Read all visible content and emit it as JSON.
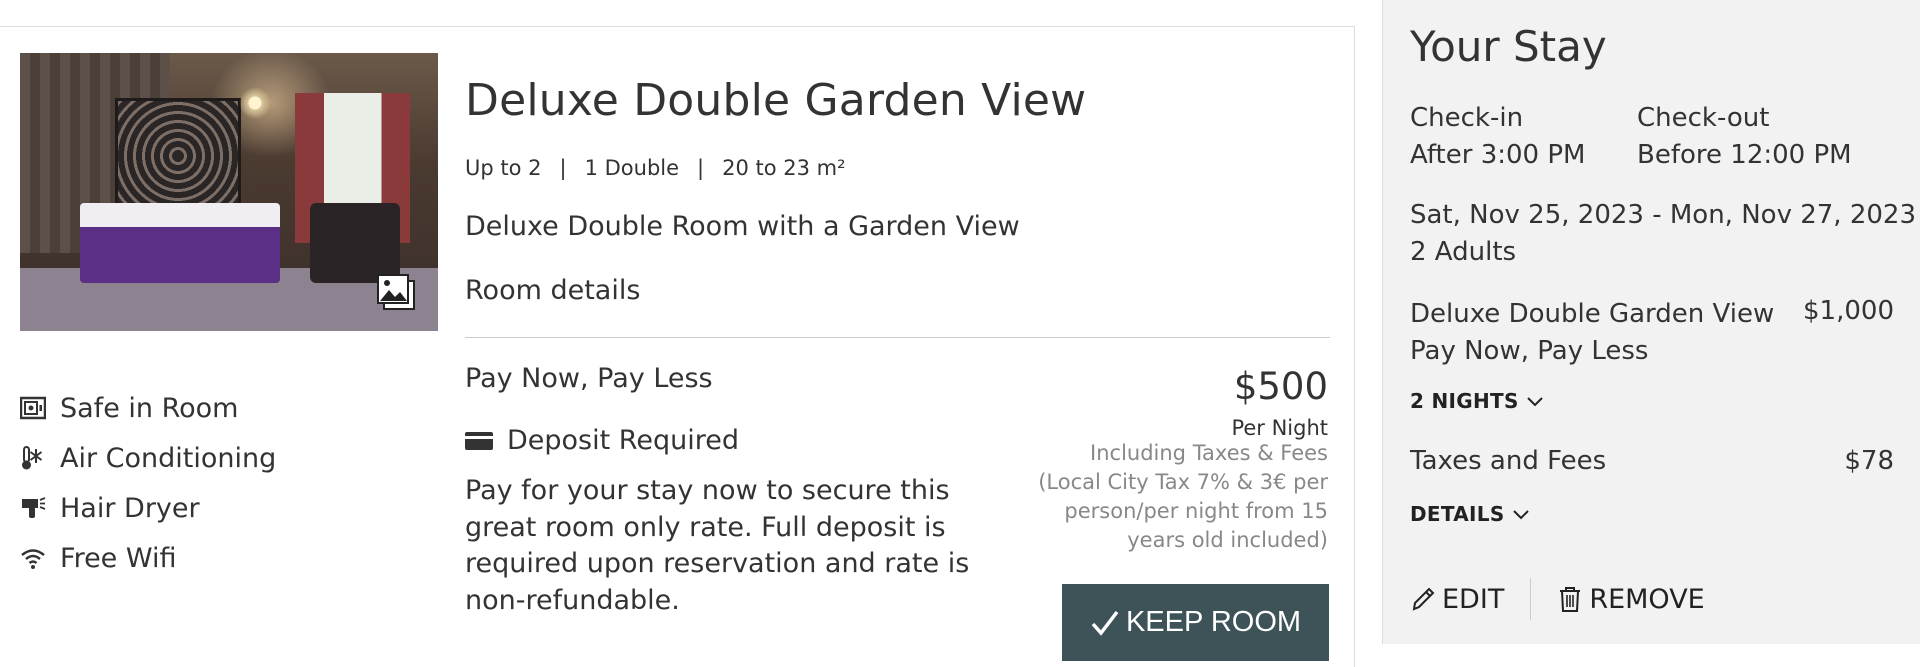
{
  "room": {
    "title": "Deluxe Double Garden View",
    "occupancy": "Up to 2",
    "bed": "1 Double",
    "size": "20 to 23 m²",
    "description": "Deluxe Double Room with a Garden View",
    "details_link": "Room details",
    "amenities": [
      {
        "label": "Safe in Room",
        "icon": "safe-icon"
      },
      {
        "label": "Air Conditioning",
        "icon": "thermometer-snowflake-icon"
      },
      {
        "label": "Hair Dryer",
        "icon": "hair-dryer-icon"
      },
      {
        "label": "Free Wifi",
        "icon": "wifi-icon"
      }
    ],
    "gallery_icon": "gallery-icon"
  },
  "rate": {
    "name": "Pay Now, Pay Less",
    "deposit_label": "Deposit Required",
    "deposit_icon": "credit-card-icon",
    "description": "Pay for your stay now to secure this great room only rate. Full deposit is required upon reservation and rate is non-refundable.",
    "price": "$500",
    "per": "Per Night",
    "tax_note": "Including Taxes & Fees (Local City Tax 7% & 3€ per person/per night from 15 years old included)",
    "keep_button": "KEEP ROOM",
    "keep_icon": "checkmark-icon"
  },
  "summary": {
    "title": "Your Stay",
    "checkin_label": "Check-in",
    "checkin_value": "After 3:00 PM",
    "checkout_label": "Check-out",
    "checkout_value": "Before 12:00 PM",
    "dates": "Sat, Nov 25, 2023 - Mon, Nov 27, 2023",
    "guests": "2 Adults",
    "room_name": "Deluxe Double Garden View",
    "room_price": "$1,000",
    "rate_name": "Pay Now, Pay Less",
    "nights_toggle": "2 NIGHTS",
    "taxes_label": "Taxes and Fees",
    "taxes_price": "$78",
    "details_toggle": "DETAILS",
    "edit": "EDIT",
    "remove": "REMOVE"
  },
  "colors": {
    "button_bg": "#3e5358",
    "summary_bg": "#f2f2f2",
    "muted_text": "#888888"
  }
}
